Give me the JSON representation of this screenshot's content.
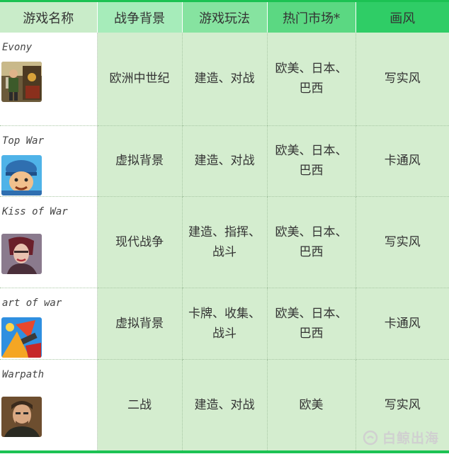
{
  "table": {
    "headers": [
      {
        "label": "游戏名称",
        "bg": "#c9ecc9"
      },
      {
        "label": "战争背景",
        "bg": "#a6ecba"
      },
      {
        "label": "游戏玩法",
        "bg": "#86e3a0"
      },
      {
        "label": "热门市场*",
        "bg": "#5bd882"
      },
      {
        "label": "画风",
        "bg": "#2fcd66"
      }
    ],
    "rows": [
      {
        "name": "Evony",
        "icon": "evony-game-icon",
        "war_background": "欧洲中世纪",
        "gameplay": [
          "建造、对战"
        ],
        "market": [
          "欧美、日本、",
          "巴西"
        ],
        "style": "写实风"
      },
      {
        "name": "Top War",
        "icon": "top-war-game-icon",
        "war_background": "虚拟背景",
        "gameplay": [
          "建造、对战"
        ],
        "market": [
          "欧美、日本、",
          "巴西"
        ],
        "style": "卡通风"
      },
      {
        "name": "Kiss of War",
        "icon": "kiss-of-war-game-icon",
        "war_background": "现代战争",
        "gameplay": [
          "建造、指挥、",
          "战斗"
        ],
        "market": [
          "欧美、日本、",
          "巴西"
        ],
        "style": "写实风"
      },
      {
        "name": "art of war",
        "icon": "art-of-war-game-icon",
        "war_background": "虚拟背景",
        "gameplay": [
          "卡牌、收集、",
          "战斗"
        ],
        "market": [
          "欧美、日本、",
          "巴西"
        ],
        "style": "卡通风"
      },
      {
        "name": "Warpath",
        "icon": "warpath-game-icon",
        "war_background": "二战",
        "gameplay": [
          "建造、对战"
        ],
        "market": [
          "欧美"
        ],
        "style": "写实风"
      }
    ]
  },
  "watermark": {
    "text": "白鲸出海",
    "icon": "whale-logo-icon"
  }
}
